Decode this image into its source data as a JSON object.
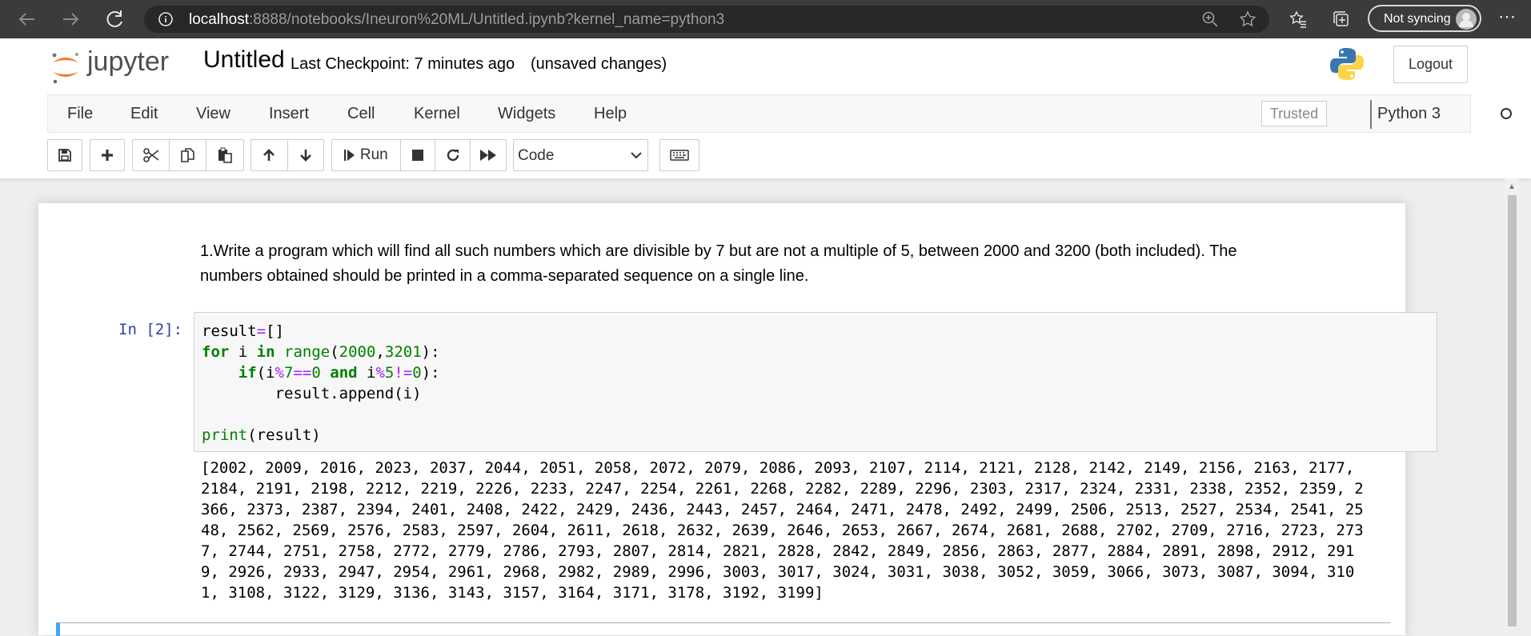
{
  "browser": {
    "url_host": "localhost",
    "url_rest": ":8888/notebooks/Ineuron%20ML/Untitled.ipynb?kernel_name=python3",
    "sync_label": "Not syncing"
  },
  "header": {
    "logo_text": "jupyter",
    "notebook_name": "Untitled",
    "checkpoint": "Last Checkpoint: 7 minutes ago",
    "autosave_status": "(unsaved changes)",
    "logout_label": "Logout"
  },
  "menubar": {
    "items": [
      "File",
      "Edit",
      "View",
      "Insert",
      "Cell",
      "Kernel",
      "Widgets",
      "Help"
    ],
    "trusted_label": "Trusted",
    "kernel_name": "Python 3"
  },
  "toolbar": {
    "run_label": "Run",
    "cell_type": "Code"
  },
  "notebook": {
    "markdown": "1.Write a program which will find all such numbers which are divisible by 7 but are not a multiple of 5, between 2000 and 3200 (both included). The numbers obtained should be printed in a comma-separated sequence on a single line.",
    "input_prompt": "In [2]:",
    "code_lines": [
      "result=[]",
      "for i in range(2000,3201):",
      "    if(i%7==0 and i%5!=0):",
      "        result.append(i)",
      "",
      "print(result)"
    ],
    "output_lines": [
      "[2002, 2009, 2016, 2023, 2037, 2044, 2051, 2058, 2072, 2079, 2086, 2093, 2107, 2114, 2121, 2128, 2142, 2149, 2156, 2163, 2177,",
      "2184, 2191, 2198, 2212, 2219, 2226, 2233, 2247, 2254, 2261, 2268, 2282, 2289, 2296, 2303, 2317, 2324, 2331, 2338, 2352, 2359, 2",
      "366, 2373, 2387, 2394, 2401, 2408, 2422, 2429, 2436, 2443, 2457, 2464, 2471, 2478, 2492, 2499, 2506, 2513, 2527, 2534, 2541, 25",
      "48, 2562, 2569, 2576, 2583, 2597, 2604, 2611, 2618, 2632, 2639, 2646, 2653, 2667, 2674, 2681, 2688, 2702, 2709, 2716, 2723, 273",
      "7, 2744, 2751, 2758, 2772, 2779, 2786, 2793, 2807, 2814, 2821, 2828, 2842, 2849, 2856, 2863, 2877, 2884, 2891, 2898, 2912, 291",
      "9, 2926, 2933, 2947, 2954, 2961, 2968, 2982, 2989, 2996, 3003, 3017, 3024, 3031, 3038, 3052, 3059, 3066, 3073, 3087, 3094, 310",
      "1, 3108, 3122, 3129, 3136, 3143, 3157, 3164, 3171, 3178, 3192, 3199]"
    ]
  },
  "colors": {
    "jupyter_orange": "#f37726",
    "prompt_blue": "#303f9f",
    "keyword_green": "#008000",
    "operator_purple": "#aa22ff"
  }
}
